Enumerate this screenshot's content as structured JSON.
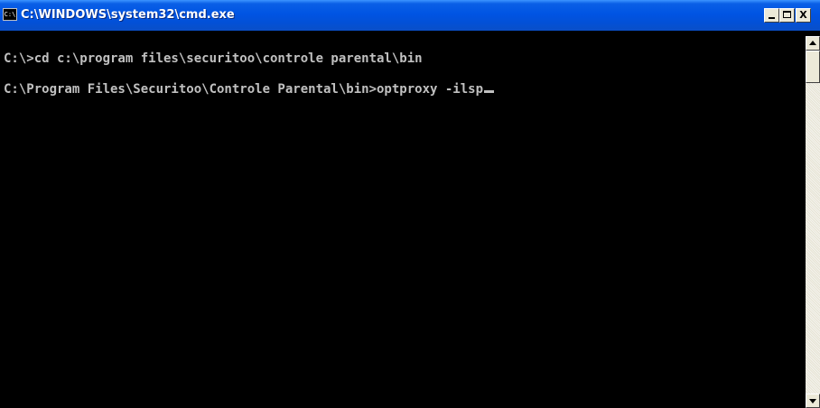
{
  "window": {
    "title": "C:\\WINDOWS\\system32\\cmd.exe",
    "icon_label": "C:\\",
    "icon": "cmd-window-icon"
  },
  "controls": {
    "minimize": {
      "icon": "minimize-icon",
      "label": "_"
    },
    "maximize": {
      "icon": "maximize-icon"
    },
    "close": {
      "icon": "close-icon",
      "label": "X"
    }
  },
  "console": {
    "lines": [
      "C:\\>cd c:\\program files\\securitoo\\controle parental\\bin",
      "C:\\Program Files\\Securitoo\\Controle Parental\\bin>optproxy -ilsp"
    ],
    "cursor": "_"
  },
  "colors": {
    "console_background": "#000000",
    "console_text": "#c0c0c0",
    "titlebar": "#0054e3",
    "control_face": "#ece9d8"
  },
  "scrollbar": {
    "up_icon": "arrow-up-icon",
    "down_icon": "arrow-down-icon",
    "position": 0
  }
}
